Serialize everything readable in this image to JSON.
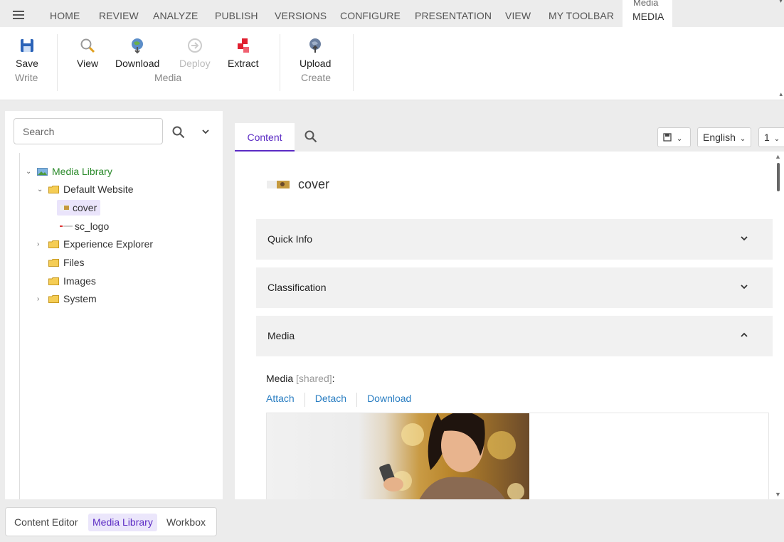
{
  "topbar": {
    "tabs": [
      "HOME",
      "REVIEW",
      "ANALYZE",
      "PUBLISH",
      "VERSIONS",
      "CONFIGURE",
      "PRESENTATION",
      "VIEW",
      "MY TOOLBAR"
    ],
    "active_tab_caption": "Media",
    "active_tab": "MEDIA"
  },
  "ribbon": {
    "save": "Save",
    "write_group": "Write",
    "view": "View",
    "download": "Download",
    "deploy": "Deploy",
    "extract": "Extract",
    "media_group": "Media",
    "upload": "Upload",
    "create_group": "Create"
  },
  "left": {
    "search_placeholder": "Search",
    "tree": {
      "media_library": "Media Library",
      "default_website": "Default Website",
      "cover": "cover",
      "sc_logo": "sc_logo",
      "experience_explorer": "Experience Explorer",
      "files": "Files",
      "images": "Images",
      "system": "System"
    }
  },
  "bottom_tabs": {
    "content_editor": "Content Editor",
    "media_library": "Media Library",
    "workbox": "Workbox"
  },
  "right": {
    "content_tab": "Content",
    "language": "English",
    "version": "1",
    "item_title": "cover",
    "sections": {
      "quick_info": "Quick Info",
      "classification": "Classification",
      "media": "Media"
    },
    "media_field": {
      "label": "Media",
      "shared": "[shared]",
      "colon": ":",
      "attach": "Attach",
      "detach": "Detach",
      "download": "Download"
    }
  },
  "colors": {
    "accent": "#5b2bc4",
    "link": "#2a7ec2",
    "tree_root": "#2a8a2a"
  }
}
